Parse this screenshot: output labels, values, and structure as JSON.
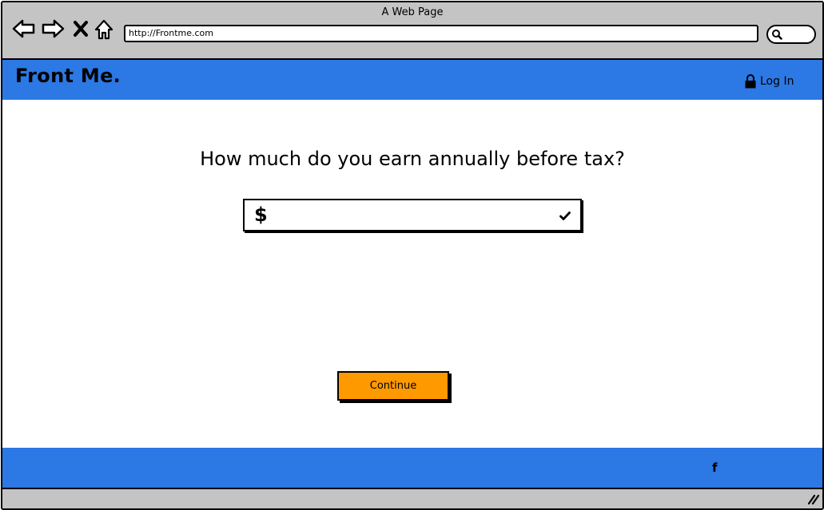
{
  "browser": {
    "title": "A Web Page",
    "url": "http://Frontme.com"
  },
  "header": {
    "brand": "Front Me.",
    "login_label": "Log In"
  },
  "main": {
    "question": "How much do you earn annually before tax?",
    "currency_symbol": "$",
    "income_value": "",
    "continue_label": "Continue"
  },
  "footer": {
    "social_icon": "f"
  },
  "colors": {
    "accent_blue": "#2c78e4",
    "button_orange": "#ff9900",
    "chrome_gray": "#c4c4c4"
  }
}
